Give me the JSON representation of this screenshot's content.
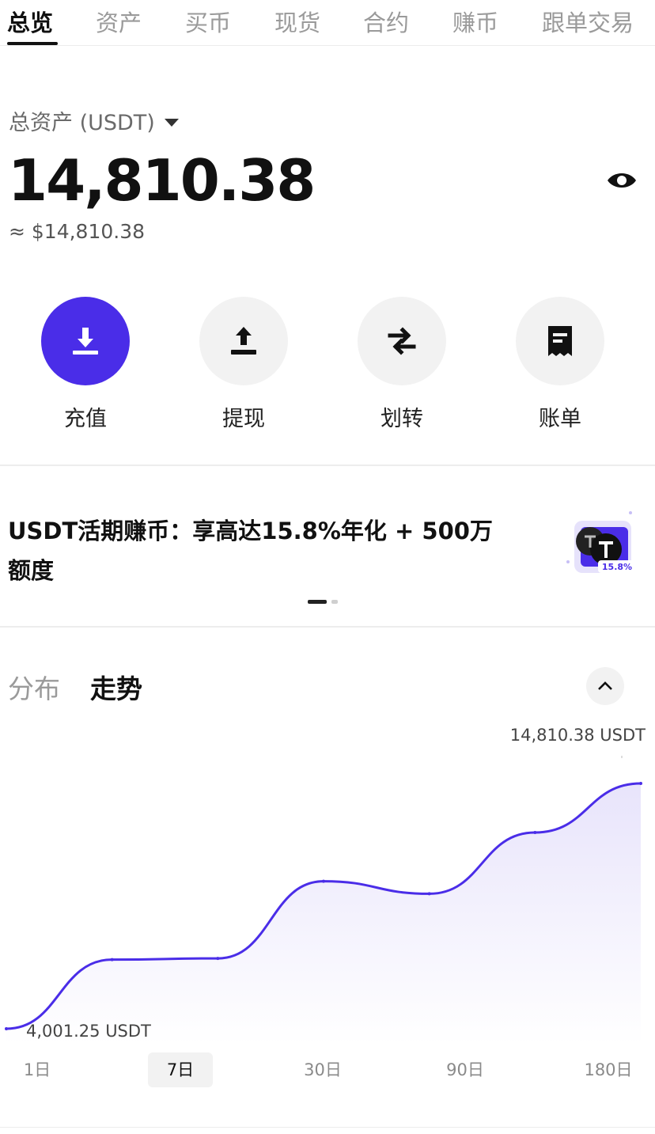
{
  "tabs": [
    "总览",
    "资产",
    "买币",
    "现货",
    "合约",
    "赚币",
    "跟单交易"
  ],
  "overview": {
    "asset_label": "总资产 (USDT)",
    "total_value": "14,810.38",
    "approx_value": "≈ $14,810.38"
  },
  "actions": [
    {
      "label": "充值",
      "icon": "download-icon"
    },
    {
      "label": "提现",
      "icon": "upload-icon"
    },
    {
      "label": "划转",
      "icon": "transfer-icon"
    },
    {
      "label": "账单",
      "icon": "bill-icon"
    }
  ],
  "promo": {
    "text": "USDT活期赚币：享高达15.8%年化 + 500万额度",
    "badge": "15.8%"
  },
  "section_tabs": {
    "distribution": "分布",
    "trend": "走势"
  },
  "chart_data": {
    "type": "area",
    "x": [
      "day 1",
      "day 2",
      "day 3",
      "day 4",
      "day 5",
      "day 6",
      "day 7"
    ],
    "values": [
      4001.25,
      7050,
      7100,
      10500,
      9950,
      12650,
      14810.38
    ],
    "max_label": "14,810.38 USDT",
    "min_label": "4,001.25 USDT",
    "line_color": "#4a2de8",
    "fill_color": "#ede9fb"
  },
  "ranges": [
    "1日",
    "7日",
    "30日",
    "90日",
    "180日"
  ],
  "selected_range": "7日",
  "colors": {
    "accent": "#4a2de8"
  }
}
